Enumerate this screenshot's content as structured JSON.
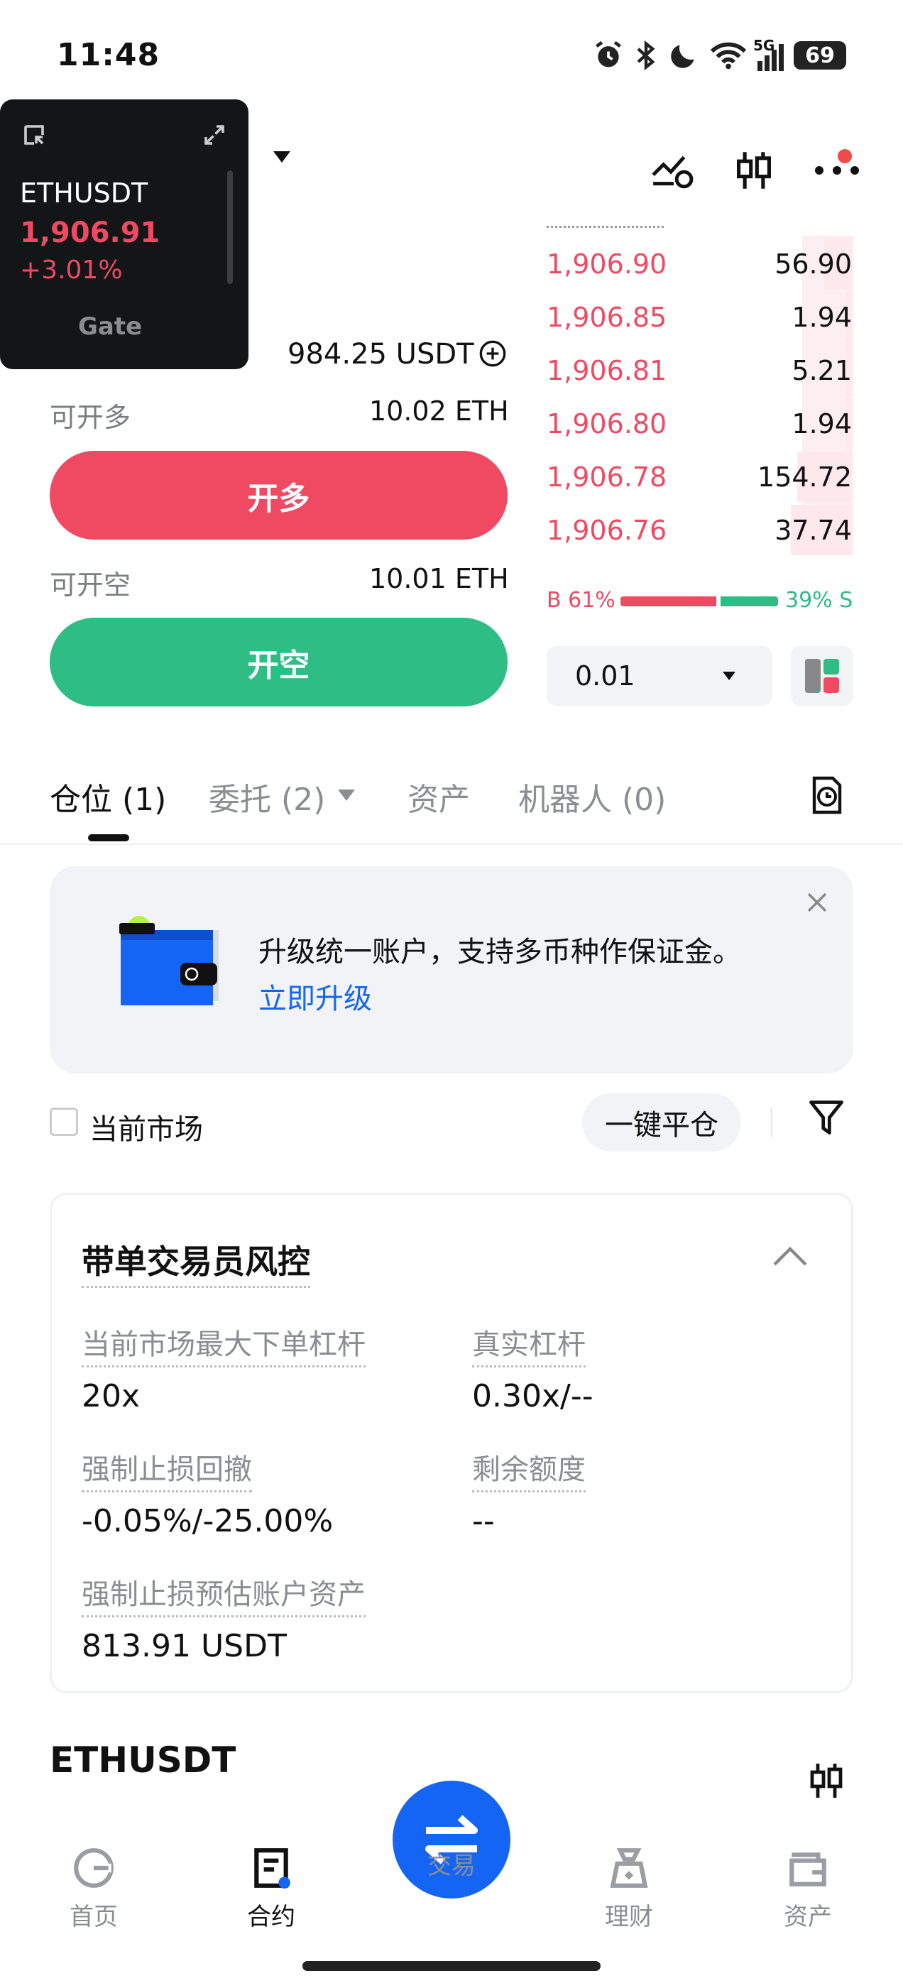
{
  "status_bar": {
    "time": "11:48",
    "network": "5G",
    "battery": "69"
  },
  "ticker": {
    "symbol": "ETHUSDT",
    "price": "1,906.91",
    "change": "+3.01%",
    "brand": "Gate"
  },
  "account": {
    "available": "984.25 USDT"
  },
  "long": {
    "label": "可开多",
    "value": "10.02 ETH",
    "button": "开多"
  },
  "short": {
    "label": "可开空",
    "value": "10.01 ETH",
    "button": "开空"
  },
  "orderbook": {
    "rows": [
      {
        "price": "1,906.90",
        "qty": "56.90",
        "depth": 0.09
      },
      {
        "price": "1,906.85",
        "qty": "1.94",
        "depth": 0.02
      },
      {
        "price": "1,906.81",
        "qty": "5.21",
        "depth": 0.02
      },
      {
        "price": "1,906.80",
        "qty": "1.94",
        "depth": 0.02
      },
      {
        "price": "1,906.78",
        "qty": "154.72",
        "depth": 0.18
      },
      {
        "price": "1,906.76",
        "qty": "37.74",
        "depth": 0.2
      }
    ],
    "buy_ratio": "B 61%",
    "sell_ratio": "39% S",
    "buy_fraction": 0.61,
    "precision": "0.01"
  },
  "tabs": [
    {
      "label": "仓位 (1)"
    },
    {
      "label": "委托 (2)"
    },
    {
      "label": "资产"
    },
    {
      "label": "机器人 (0)"
    }
  ],
  "banner": {
    "text": "升级统一账户，支持多币种作保证金。",
    "link": "立即升级"
  },
  "filter": {
    "checkbox_label": "当前市场",
    "close_all": "一键平仓"
  },
  "risk_card": {
    "title": "带单交易员风控",
    "items": [
      {
        "key": "当前市场最大下单杠杆",
        "value": "20x"
      },
      {
        "key": "真实杠杆",
        "value": "0.30x/--"
      },
      {
        "key": "强制止损回撤",
        "value": "-0.05%/-25.00%"
      },
      {
        "key": "剩余额度",
        "value": "--"
      },
      {
        "key": "强制止损预估账户资产",
        "value": "813.91 USDT"
      }
    ]
  },
  "position": {
    "symbol": "ETHUSDT"
  },
  "nav": {
    "home": "首页",
    "contract": "合约",
    "trade": "交易",
    "finance": "理财",
    "assets": "资产"
  },
  "colors": {
    "red": "#f04a63",
    "green": "#2ebd85",
    "blue": "#1565f5"
  }
}
